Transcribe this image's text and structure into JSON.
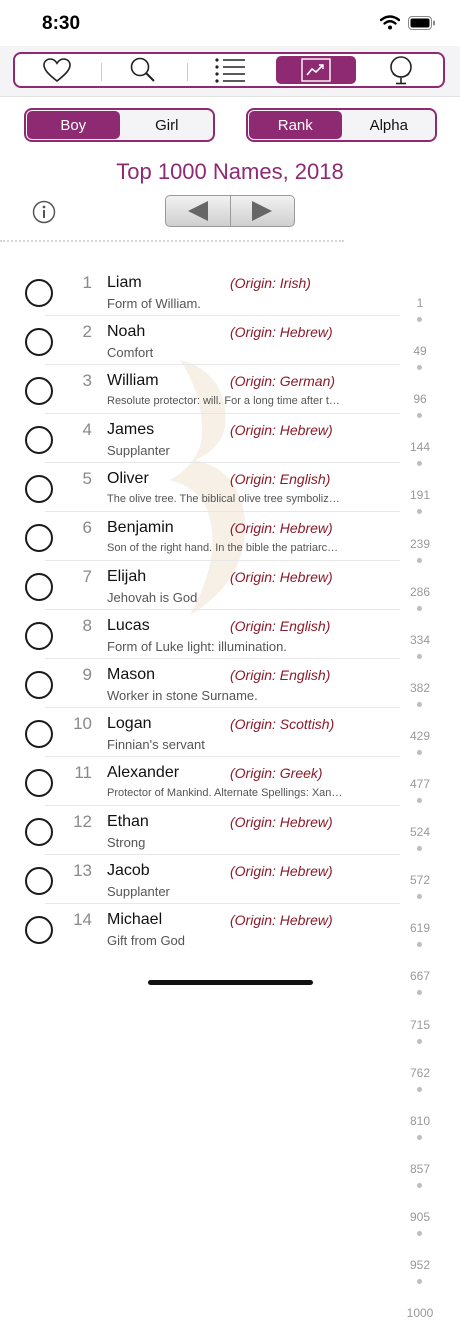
{
  "status": {
    "time": "8:30"
  },
  "tabs": [
    {
      "icon": "heart-icon"
    },
    {
      "icon": "search-icon"
    },
    {
      "icon": "list-icon"
    },
    {
      "icon": "chart-icon",
      "active": true
    },
    {
      "icon": "globe-icon"
    }
  ],
  "gender_segment": {
    "boy": "Boy",
    "girl": "Girl",
    "selected": "Boy"
  },
  "sort_segment": {
    "rank": "Rank",
    "alpha": "Alpha",
    "selected": "Rank"
  },
  "title": "Top 1000 Names, 2018",
  "names": [
    {
      "rank": "1",
      "name": "Liam",
      "origin": "(Origin: Irish)",
      "meaning": "Form of William."
    },
    {
      "rank": "2",
      "name": "Noah",
      "origin": "(Origin: Hebrew)",
      "meaning": "Comfort"
    },
    {
      "rank": "3",
      "name": "William",
      "origin": "(Origin: German)",
      "meaning": "Resolute protector: will. For a long time after t…"
    },
    {
      "rank": "4",
      "name": "James",
      "origin": "(Origin: Hebrew)",
      "meaning": "Supplanter"
    },
    {
      "rank": "5",
      "name": "Oliver",
      "origin": "(Origin: English)",
      "meaning": "The olive tree. The biblical olive tree symboliz…"
    },
    {
      "rank": "6",
      "name": "Benjamin",
      "origin": "(Origin: Hebrew)",
      "meaning": "Son of the right hand. In the bible the patriarc…"
    },
    {
      "rank": "7",
      "name": "Elijah",
      "origin": "(Origin: Hebrew)",
      "meaning": "Jehovah is God"
    },
    {
      "rank": "8",
      "name": "Lucas",
      "origin": "(Origin: English)",
      "meaning": "Form of Luke light: illumination."
    },
    {
      "rank": "9",
      "name": "Mason",
      "origin": "(Origin: English)",
      "meaning": "Worker in stone Surname."
    },
    {
      "rank": "10",
      "name": "Logan",
      "origin": "(Origin: Scottish)",
      "meaning": "Finnian's servant"
    },
    {
      "rank": "11",
      "name": "Alexander",
      "origin": "(Origin: Greek)",
      "meaning": "Protector of Mankind. Alternate Spellings: Xan…"
    },
    {
      "rank": "12",
      "name": "Ethan",
      "origin": "(Origin: Hebrew)",
      "meaning": "Strong"
    },
    {
      "rank": "13",
      "name": "Jacob",
      "origin": "(Origin: Hebrew)",
      "meaning": "Supplanter"
    },
    {
      "rank": "14",
      "name": "Michael",
      "origin": "(Origin: Hebrew)",
      "meaning": "Gift from God"
    }
  ],
  "index": [
    "1",
    "49",
    "96",
    "144",
    "191",
    "239",
    "286",
    "334",
    "382",
    "429",
    "477",
    "524",
    "572",
    "619",
    "667",
    "715",
    "762",
    "810",
    "857",
    "905",
    "952",
    "1000"
  ],
  "colors": {
    "accent": "#8e2a72",
    "origin": "#8b1a2a"
  }
}
